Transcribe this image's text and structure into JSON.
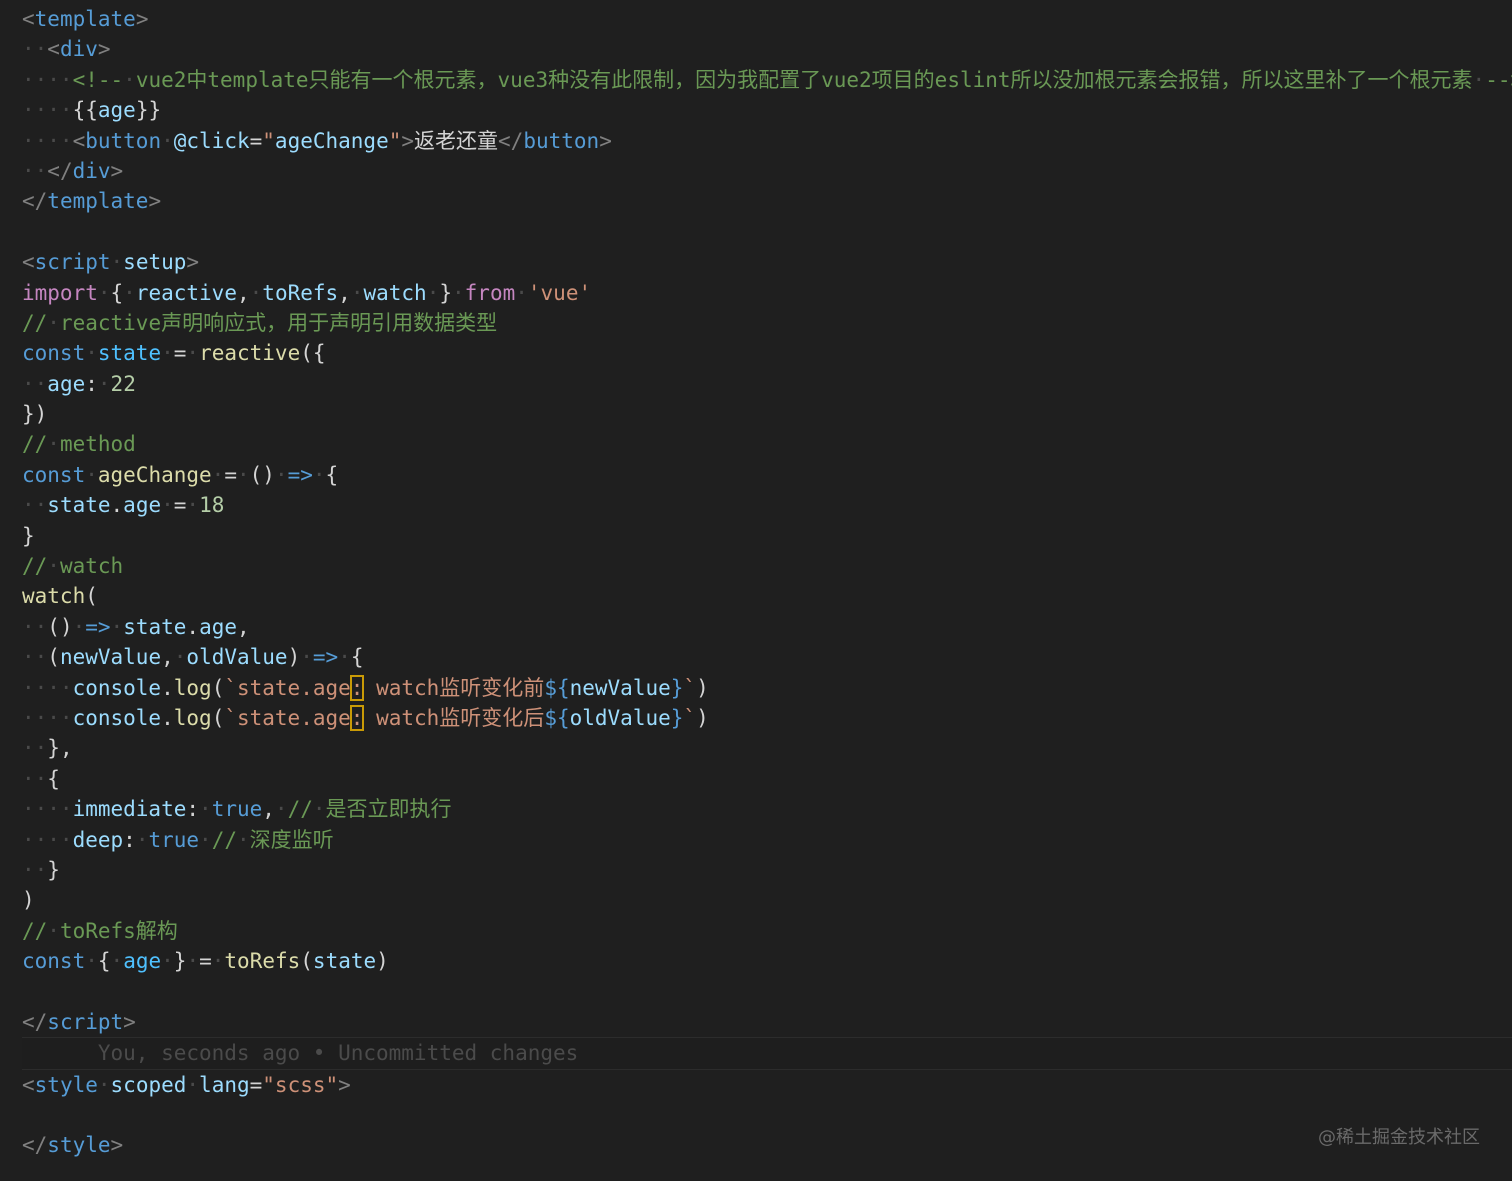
{
  "editor": {
    "language": "vue",
    "watermark": "@稀土掘金技术社区",
    "colors": {
      "background": "#1f1f1f",
      "keyword": "#569cd6",
      "string": "#ce9178",
      "comment": "#6a9955",
      "function": "#dcdcaa",
      "variable": "#9cdcfe",
      "number": "#b5cea8",
      "highlight_border": "#c99a06"
    },
    "lines": [
      [
        {
          "c": "tag",
          "t": "<"
        },
        {
          "c": "tn",
          "t": "template"
        },
        {
          "c": "tag",
          "t": ">"
        }
      ],
      [
        {
          "c": "ws",
          "t": "··"
        },
        {
          "c": "tag",
          "t": "<"
        },
        {
          "c": "tn",
          "t": "div"
        },
        {
          "c": "tag",
          "t": ">"
        }
      ],
      [
        {
          "c": "ws",
          "t": "····"
        },
        {
          "c": "cm",
          "t": "<!--"
        },
        {
          "c": "ws",
          "t": "·"
        },
        {
          "c": "cm",
          "t": "vue2中template只能有一个根元素，vue3种没有此限制，因为我配置了vue2项目的eslint所以没加根元素会报错，所以这里补了一个根元素"
        },
        {
          "c": "ws",
          "t": "·"
        },
        {
          "c": "cm",
          "t": "-->"
        }
      ],
      [
        {
          "c": "ws",
          "t": "····"
        },
        {
          "c": "txt",
          "t": "{{"
        },
        {
          "c": "var",
          "t": "age"
        },
        {
          "c": "txt",
          "t": "}}"
        }
      ],
      [
        {
          "c": "ws",
          "t": "····"
        },
        {
          "c": "tag",
          "t": "<"
        },
        {
          "c": "tn",
          "t": "button"
        },
        {
          "c": "ws",
          "t": "·"
        },
        {
          "c": "at",
          "t": "@click"
        },
        {
          "c": "pun",
          "t": "="
        },
        {
          "c": "str",
          "t": "\""
        },
        {
          "c": "var",
          "t": "ageChange"
        },
        {
          "c": "str",
          "t": "\""
        },
        {
          "c": "tag",
          "t": ">"
        },
        {
          "c": "txt",
          "t": "返老还童"
        },
        {
          "c": "tag",
          "t": "</"
        },
        {
          "c": "tn",
          "t": "button"
        },
        {
          "c": "tag",
          "t": ">"
        }
      ],
      [
        {
          "c": "ws",
          "t": "··"
        },
        {
          "c": "tag",
          "t": "</"
        },
        {
          "c": "tn",
          "t": "div"
        },
        {
          "c": "tag",
          "t": ">"
        }
      ],
      [
        {
          "c": "tag",
          "t": "</"
        },
        {
          "c": "tn",
          "t": "template"
        },
        {
          "c": "tag",
          "t": ">"
        }
      ],
      [],
      [
        {
          "c": "tag",
          "t": "<"
        },
        {
          "c": "tn",
          "t": "script"
        },
        {
          "c": "ws",
          "t": "·"
        },
        {
          "c": "at",
          "t": "setup"
        },
        {
          "c": "tag",
          "t": ">"
        }
      ],
      [
        {
          "c": "ctl",
          "t": "import"
        },
        {
          "c": "ws",
          "t": "·"
        },
        {
          "c": "pun",
          "t": "{"
        },
        {
          "c": "ws",
          "t": "·"
        },
        {
          "c": "var",
          "t": "reactive"
        },
        {
          "c": "pun",
          "t": ","
        },
        {
          "c": "ws",
          "t": "·"
        },
        {
          "c": "var",
          "t": "toRefs"
        },
        {
          "c": "pun",
          "t": ","
        },
        {
          "c": "ws",
          "t": "·"
        },
        {
          "c": "var",
          "t": "watch"
        },
        {
          "c": "ws",
          "t": "·"
        },
        {
          "c": "pun",
          "t": "}"
        },
        {
          "c": "ws",
          "t": "·"
        },
        {
          "c": "ctl",
          "t": "from"
        },
        {
          "c": "ws",
          "t": "·"
        },
        {
          "c": "str",
          "t": "'vue'"
        }
      ],
      [
        {
          "c": "cm",
          "t": "//"
        },
        {
          "c": "ws",
          "t": "·"
        },
        {
          "c": "cm",
          "t": "reactive声明响应式，用于声明引用数据类型"
        }
      ],
      [
        {
          "c": "kw",
          "t": "const"
        },
        {
          "c": "ws",
          "t": "·"
        },
        {
          "c": "cst",
          "t": "state"
        },
        {
          "c": "ws",
          "t": "·"
        },
        {
          "c": "pun",
          "t": "="
        },
        {
          "c": "ws",
          "t": "·"
        },
        {
          "c": "fn",
          "t": "reactive"
        },
        {
          "c": "pun",
          "t": "({"
        }
      ],
      [
        {
          "c": "ws",
          "t": "··"
        },
        {
          "c": "var",
          "t": "age"
        },
        {
          "c": "pun",
          "t": ":"
        },
        {
          "c": "ws",
          "t": "·"
        },
        {
          "c": "num",
          "t": "22"
        }
      ],
      [
        {
          "c": "pun",
          "t": "})"
        }
      ],
      [
        {
          "c": "cm",
          "t": "//"
        },
        {
          "c": "ws",
          "t": "·"
        },
        {
          "c": "cm",
          "t": "method"
        }
      ],
      [
        {
          "c": "kw",
          "t": "const"
        },
        {
          "c": "ws",
          "t": "·"
        },
        {
          "c": "fn",
          "t": "ageChange"
        },
        {
          "c": "ws",
          "t": "·"
        },
        {
          "c": "pun",
          "t": "="
        },
        {
          "c": "ws",
          "t": "·"
        },
        {
          "c": "pun",
          "t": "()"
        },
        {
          "c": "ws",
          "t": "·"
        },
        {
          "c": "kw",
          "t": "=>"
        },
        {
          "c": "ws",
          "t": "·"
        },
        {
          "c": "pun",
          "t": "{"
        }
      ],
      [
        {
          "c": "ws",
          "t": "··"
        },
        {
          "c": "var",
          "t": "state"
        },
        {
          "c": "pun",
          "t": "."
        },
        {
          "c": "var",
          "t": "age"
        },
        {
          "c": "ws",
          "t": "·"
        },
        {
          "c": "pun",
          "t": "="
        },
        {
          "c": "ws",
          "t": "·"
        },
        {
          "c": "num",
          "t": "18"
        }
      ],
      [
        {
          "c": "pun",
          "t": "}"
        }
      ],
      [
        {
          "c": "cm",
          "t": "//"
        },
        {
          "c": "ws",
          "t": "·"
        },
        {
          "c": "cm",
          "t": "watch"
        }
      ],
      [
        {
          "c": "fn",
          "t": "watch"
        },
        {
          "c": "pun",
          "t": "("
        }
      ],
      [
        {
          "c": "ws",
          "t": "··"
        },
        {
          "c": "pun",
          "t": "()"
        },
        {
          "c": "ws",
          "t": "·"
        },
        {
          "c": "kw",
          "t": "=>"
        },
        {
          "c": "ws",
          "t": "·"
        },
        {
          "c": "var",
          "t": "state"
        },
        {
          "c": "pun",
          "t": "."
        },
        {
          "c": "var",
          "t": "age"
        },
        {
          "c": "pun",
          "t": ","
        }
      ],
      [
        {
          "c": "ws",
          "t": "··"
        },
        {
          "c": "pun",
          "t": "("
        },
        {
          "c": "var",
          "t": "newValue"
        },
        {
          "c": "pun",
          "t": ","
        },
        {
          "c": "ws",
          "t": "·"
        },
        {
          "c": "var",
          "t": "oldValue"
        },
        {
          "c": "pun",
          "t": ")"
        },
        {
          "c": "ws",
          "t": "·"
        },
        {
          "c": "kw",
          "t": "=>"
        },
        {
          "c": "ws",
          "t": "·"
        },
        {
          "c": "pun",
          "t": "{"
        }
      ],
      [
        {
          "c": "ws",
          "t": "····"
        },
        {
          "c": "var",
          "t": "console"
        },
        {
          "c": "pun",
          "t": "."
        },
        {
          "c": "fn",
          "t": "log"
        },
        {
          "c": "pun",
          "t": "("
        },
        {
          "c": "str",
          "t": "`state.age"
        },
        {
          "c": "str hl",
          "t": ":"
        },
        {
          "c": "str",
          "t": " "
        },
        {
          "c": "str",
          "t": "watch监听变化前"
        },
        {
          "c": "kw",
          "t": "${"
        },
        {
          "c": "var",
          "t": "newValue"
        },
        {
          "c": "kw",
          "t": "}"
        },
        {
          "c": "str",
          "t": "`"
        },
        {
          "c": "pun",
          "t": ")"
        }
      ],
      [
        {
          "c": "ws",
          "t": "····"
        },
        {
          "c": "var",
          "t": "console"
        },
        {
          "c": "pun",
          "t": "."
        },
        {
          "c": "fn",
          "t": "log"
        },
        {
          "c": "pun",
          "t": "("
        },
        {
          "c": "str",
          "t": "`state.age"
        },
        {
          "c": "str hl",
          "t": ":"
        },
        {
          "c": "str",
          "t": " "
        },
        {
          "c": "str",
          "t": "watch监听变化后"
        },
        {
          "c": "kw",
          "t": "${"
        },
        {
          "c": "var",
          "t": "oldValue"
        },
        {
          "c": "kw",
          "t": "}"
        },
        {
          "c": "str",
          "t": "`"
        },
        {
          "c": "pun",
          "t": ")"
        }
      ],
      [
        {
          "c": "ws",
          "t": "··"
        },
        {
          "c": "pun",
          "t": "},"
        }
      ],
      [
        {
          "c": "ws",
          "t": "··"
        },
        {
          "c": "pun",
          "t": "{"
        }
      ],
      [
        {
          "c": "ws",
          "t": "····"
        },
        {
          "c": "var",
          "t": "immediate"
        },
        {
          "c": "pun",
          "t": ":"
        },
        {
          "c": "ws",
          "t": "·"
        },
        {
          "c": "kw",
          "t": "true"
        },
        {
          "c": "pun",
          "t": ","
        },
        {
          "c": "ws",
          "t": "·"
        },
        {
          "c": "cm",
          "t": "//"
        },
        {
          "c": "ws",
          "t": "·"
        },
        {
          "c": "cm",
          "t": "是否立即执行"
        }
      ],
      [
        {
          "c": "ws",
          "t": "····"
        },
        {
          "c": "var",
          "t": "deep"
        },
        {
          "c": "pun",
          "t": ":"
        },
        {
          "c": "ws",
          "t": "·"
        },
        {
          "c": "kw",
          "t": "true"
        },
        {
          "c": "ws",
          "t": "·"
        },
        {
          "c": "cm",
          "t": "//"
        },
        {
          "c": "ws",
          "t": "·"
        },
        {
          "c": "cm",
          "t": "深度监听"
        }
      ],
      [
        {
          "c": "ws",
          "t": "··"
        },
        {
          "c": "pun",
          "t": "}"
        }
      ],
      [
        {
          "c": "pun",
          "t": ")"
        }
      ],
      [
        {
          "c": "cm",
          "t": "//"
        },
        {
          "c": "ws",
          "t": "·"
        },
        {
          "c": "cm",
          "t": "toRefs解构"
        }
      ],
      [
        {
          "c": "kw",
          "t": "const"
        },
        {
          "c": "ws",
          "t": "·"
        },
        {
          "c": "pun",
          "t": "{"
        },
        {
          "c": "ws",
          "t": "·"
        },
        {
          "c": "cst",
          "t": "age"
        },
        {
          "c": "ws",
          "t": "·"
        },
        {
          "c": "pun",
          "t": "}"
        },
        {
          "c": "ws",
          "t": "·"
        },
        {
          "c": "pun",
          "t": "="
        },
        {
          "c": "ws",
          "t": "·"
        },
        {
          "c": "fn",
          "t": "toRefs"
        },
        {
          "c": "pun",
          "t": "("
        },
        {
          "c": "var",
          "t": "state"
        },
        {
          "c": "pun",
          "t": ")"
        }
      ],
      [],
      [
        {
          "c": "tag",
          "t": "</"
        },
        {
          "c": "tn",
          "t": "script"
        },
        {
          "c": "tag",
          "t": ">"
        }
      ],
      [
        {
          "c": "blame-text",
          "t": "      You, seconds ago • Uncommitted changes"
        }
      ],
      [
        {
          "c": "tag",
          "t": "<"
        },
        {
          "c": "tn",
          "t": "style"
        },
        {
          "c": "ws",
          "t": "·"
        },
        {
          "c": "at",
          "t": "scoped"
        },
        {
          "c": "ws",
          "t": "·"
        },
        {
          "c": "at",
          "t": "lang"
        },
        {
          "c": "pun",
          "t": "="
        },
        {
          "c": "str",
          "t": "\"scss\""
        },
        {
          "c": "tag",
          "t": ">"
        }
      ],
      [],
      [
        {
          "c": "tag",
          "t": "</"
        },
        {
          "c": "tn",
          "t": "style"
        },
        {
          "c": "tag",
          "t": ">"
        }
      ]
    ]
  }
}
